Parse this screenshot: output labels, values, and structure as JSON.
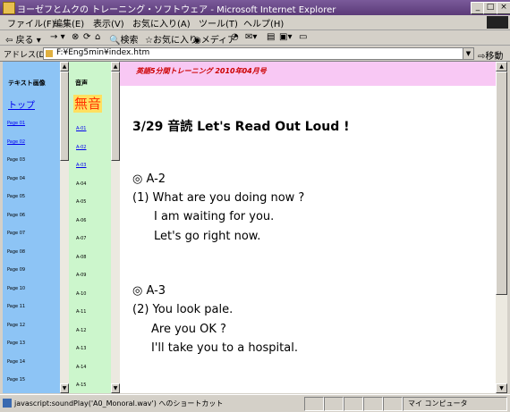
{
  "window": {
    "title": "ヨーゼフとムクの トレーニング・ソフトウェア - Microsoft Internet Explorer"
  },
  "menu": [
    "ファイル(F)",
    "編集(E)",
    "表示(V)",
    "お気に入り(A)",
    "ツール(T)",
    "ヘルプ(H)"
  ],
  "toolbar": {
    "back": "戻る",
    "forward": "→",
    "search": "検索",
    "favorites": "お気に入り",
    "media": "メディア"
  },
  "address": {
    "label": "アドレス(D)",
    "value": "F:¥Eng5min¥index.htm",
    "go": "移動"
  },
  "left": {
    "heading": "テキスト画像",
    "top_link": "トップ",
    "pages": [
      "Page 01",
      "Page 02",
      "Page 03",
      "Page 04",
      "Page 05",
      "Page 06",
      "Page 07",
      "Page 08",
      "Page 09",
      "Page 10",
      "Page 11",
      "Page 12",
      "Page 13",
      "Page 14",
      "Page 15"
    ]
  },
  "audio": {
    "heading": "音声",
    "mute": "無音",
    "items": [
      "A-01",
      "A-02",
      "A-03",
      "A-04",
      "A-05",
      "A-06",
      "A-07",
      "A-08",
      "A-09",
      "A-10",
      "A-11",
      "A-12",
      "A-13",
      "A-14",
      "A-15"
    ]
  },
  "banner": "英語5分間トレーニング  2010年04月号",
  "lesson": {
    "title": "3/29 音読   Let's Read Out Loud !",
    "sections": [
      {
        "mark": "◎ A-2",
        "lines": [
          "(1) What are you doing now ?",
          "I am waiting for you.",
          "Let's go right now."
        ]
      },
      {
        "mark": "◎ A-3",
        "lines": [
          "(2) You look pale.",
          "Are you OK ?",
          "I'll take you to a hospital."
        ]
      }
    ]
  },
  "status": {
    "message": "javascript:soundPlay('A0_Monoral.wav') へのショートカット",
    "zone": "マイ コンピュータ"
  }
}
